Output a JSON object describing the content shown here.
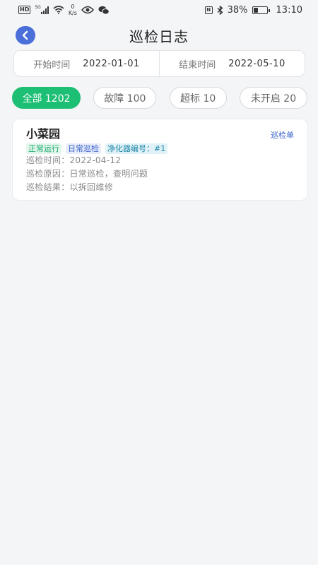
{
  "status_bar": {
    "hd": "HD",
    "network": "5G",
    "speed_value": "0",
    "speed_unit": "K/s",
    "battery_percent": "38%",
    "battery_level": 0.38,
    "time": "13:10",
    "icons": [
      "signal-icon",
      "wifi-icon",
      "eye-icon",
      "wechat-icon",
      "nfc-icon",
      "bluetooth-icon",
      "battery-icon"
    ]
  },
  "header": {
    "title": "巡检日志"
  },
  "date_range": {
    "start_label": "开始时间",
    "start_value": "2022-01-01",
    "end_label": "结束时间",
    "end_value": "2022-05-10"
  },
  "tabs": [
    {
      "label": "全部 1202",
      "active": true
    },
    {
      "label": "故障 100",
      "active": false
    },
    {
      "label": "超标 10",
      "active": false
    },
    {
      "label": "未开启 20",
      "active": false
    }
  ],
  "records": [
    {
      "title": "小菜园",
      "link": "巡检单",
      "tags": [
        "正常运行",
        "日常巡检",
        "净化器编号：#1"
      ],
      "time": "巡检时间：2022-04-12",
      "reason": "巡检原因：日常巡检，查明问题",
      "result": "巡检结果：以拆回维修"
    }
  ],
  "colors": {
    "accent_green": "#1cbf73",
    "back_button": "#4a6fd9",
    "link_blue": "#3b64c9",
    "background": "#f4f5f7"
  }
}
